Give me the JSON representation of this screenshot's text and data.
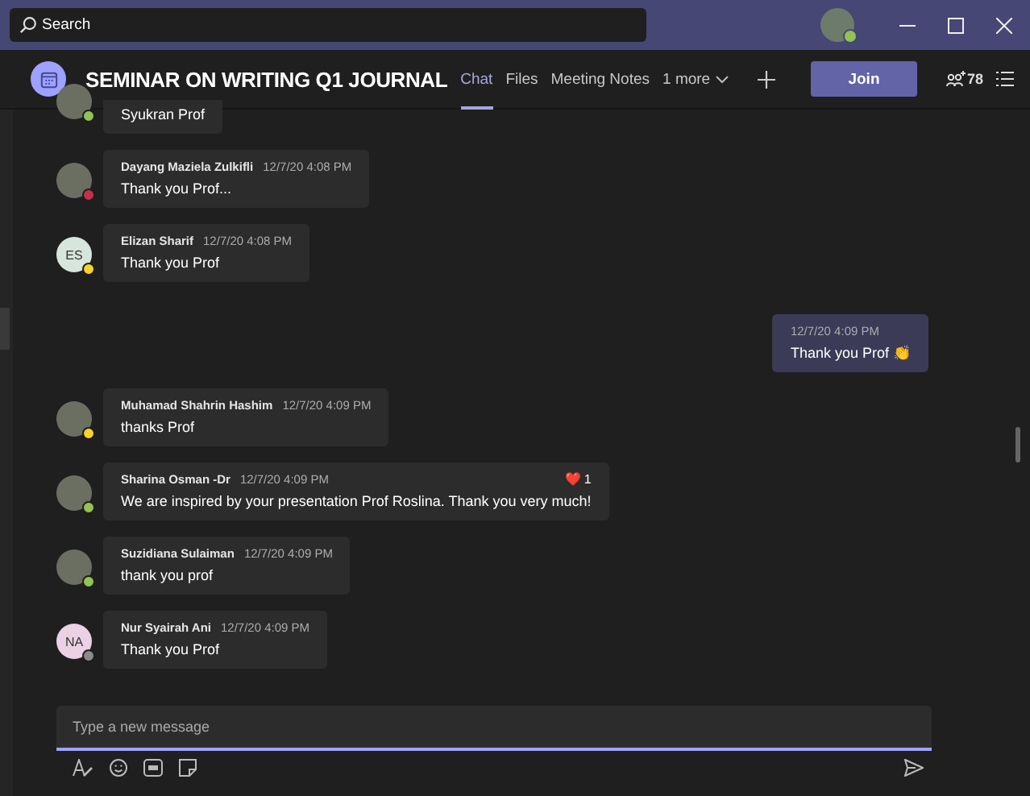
{
  "search": {
    "placeholder": "Search"
  },
  "channel": {
    "title": "SEMINAR ON WRITING Q1 JOURNAL",
    "tabs": [
      {
        "label": "Chat",
        "selected": true
      },
      {
        "label": "Files",
        "selected": false
      },
      {
        "label": "Meeting Notes",
        "selected": false
      }
    ],
    "more": "1 more",
    "join": "Join",
    "participants": "78"
  },
  "messages": [
    {
      "kind": "partial",
      "color": "#92c353",
      "text": "Syukran Prof"
    },
    {
      "kind": "other",
      "author": "Dayang Maziela Zulkifli",
      "time": "12/7/20 4:08 PM",
      "color": "#c4314b",
      "text": "Thank you Prof..."
    },
    {
      "kind": "other",
      "author": "Elizan Sharif",
      "time": "12/7/20 4:08 PM",
      "initials": "ES",
      "color": "#f8d22a",
      "text": "Thank you Prof"
    },
    {
      "kind": "self",
      "time": "12/7/20 4:09 PM",
      "text": "Thank you Prof",
      "emoji": "👏"
    },
    {
      "kind": "other",
      "author": "Muhamad Shahrin Hashim",
      "time": "12/7/20 4:09 PM",
      "color": "#f8d22a",
      "text": "thanks Prof"
    },
    {
      "kind": "other",
      "author": "Sharina Osman -Dr",
      "time": "12/7/20 4:09 PM",
      "color": "#92c353",
      "text": "We are inspired by your presentation Prof Roslina. Thank you very much!",
      "reaction": {
        "emoji": "❤️",
        "count": "1"
      }
    },
    {
      "kind": "other",
      "author": "Suzidiana Sulaiman",
      "time": "12/7/20 4:09 PM",
      "color": "#92c353",
      "text": "thank you prof"
    },
    {
      "kind": "other",
      "author": "Nur Syairah Ani",
      "time": "12/7/20 4:09 PM",
      "initials": "NA",
      "color": "#8a8a8a",
      "text": "Thank you Prof"
    }
  ],
  "composer": {
    "placeholder": "Type a new message"
  }
}
